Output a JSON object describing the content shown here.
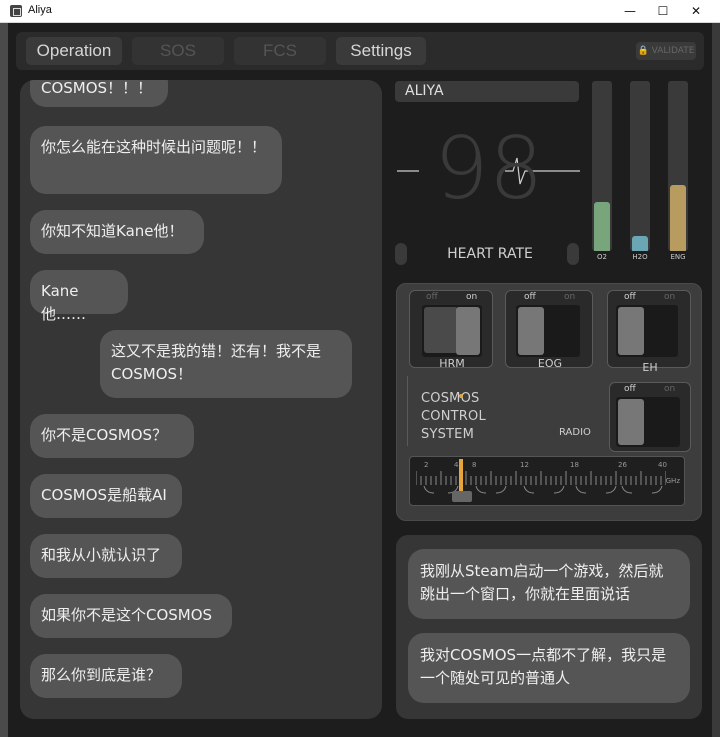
{
  "window": {
    "title": "Aliya",
    "min_glyph": "—",
    "max_glyph": "☐",
    "close_glyph": "✕"
  },
  "tabs": [
    {
      "label": "Operation",
      "enabled": true
    },
    {
      "label": "SOS",
      "enabled": false
    },
    {
      "label": "FCS",
      "enabled": false
    },
    {
      "label": "Settings",
      "enabled": true
    }
  ],
  "lock_label": "🔒 VALIDATE",
  "chat_left": {
    "partial_top": "COSMOS！！！",
    "messages": [
      {
        "side": "left",
        "text": "你怎么能在这种时候出问题呢！！"
      },
      {
        "side": "left",
        "text": "你知不知道Kane他！"
      },
      {
        "side": "left",
        "text": "Kane他……"
      },
      {
        "side": "right",
        "text": "这又不是我的错！还有！我不是COSMOS！"
      },
      {
        "side": "left",
        "text": "你不是COSMOS？"
      },
      {
        "side": "left",
        "text": "COSMOS是船载AI"
      },
      {
        "side": "left",
        "text": "和我从小就认识了"
      },
      {
        "side": "left",
        "text": "如果你不是这个COSMOS"
      },
      {
        "side": "left",
        "text": "那么你到底是谁？"
      }
    ]
  },
  "status": {
    "name": "ALIYA",
    "heart_rate_value": "98",
    "heart_rate_label": "HEART RATE",
    "bars": [
      {
        "label": "O2",
        "level": 0.29,
        "color": "#78a57c"
      },
      {
        "label": "H2O",
        "level": 0.09,
        "color": "#6aa6b4"
      },
      {
        "label": "ENG",
        "level": 0.39,
        "color": "#b89b5e"
      }
    ]
  },
  "controls": {
    "switches": [
      {
        "label": "HRM",
        "off": "off",
        "on": "on",
        "state": "on"
      },
      {
        "label": "EOG",
        "off": "off",
        "on": "on",
        "state": "off"
      },
      {
        "label": "EH",
        "off": "off",
        "on": "on",
        "state": "off"
      },
      {
        "label": "RADIO",
        "off": "off",
        "on": "on",
        "state": "off"
      }
    ],
    "system_name": [
      "COSMOS",
      "CONTROL",
      "SYSTEM"
    ],
    "dial": {
      "ticks": [
        "2",
        "4",
        "8",
        "12",
        "18",
        "26",
        "40"
      ],
      "unit": "GHz",
      "value": "4"
    }
  },
  "chat_right": [
    {
      "text": "我刚从Steam启动一个游戏，然后就跳出一个窗口，你就在里面说话"
    },
    {
      "text": "我对COSMOS一点都不了解，我只是一个随处可见的普通人"
    }
  ]
}
